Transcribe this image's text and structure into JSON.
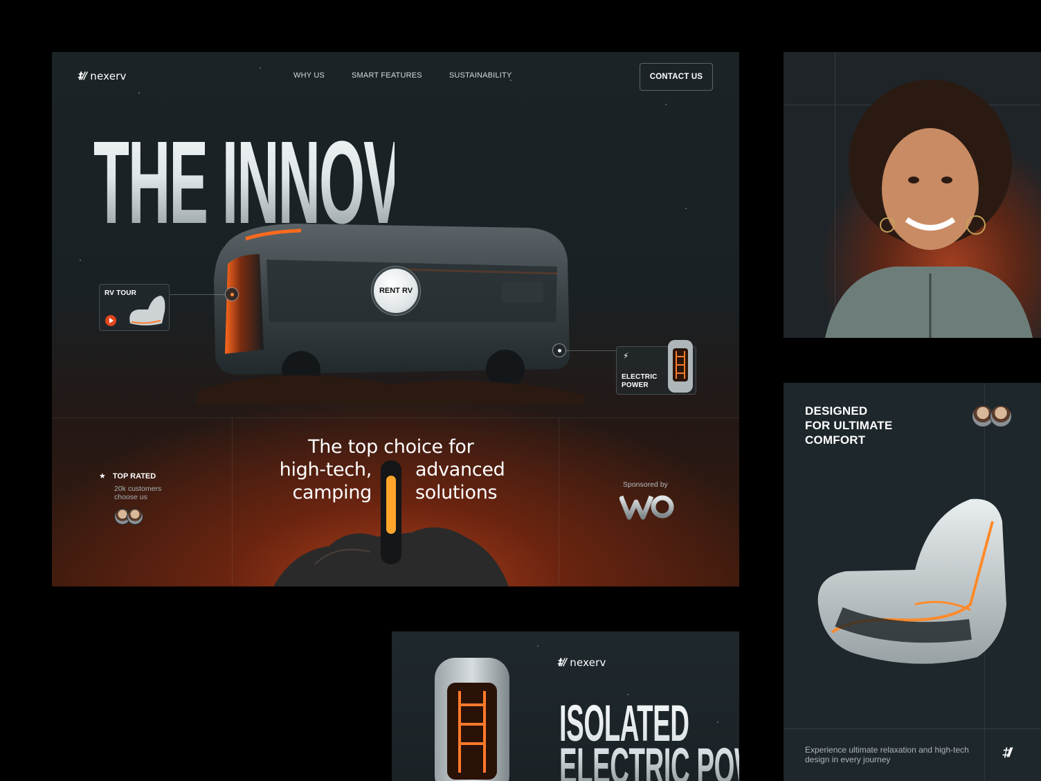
{
  "brand": {
    "name": "nexerv",
    "mark": "‡//"
  },
  "nav": {
    "items": [
      "WHY US",
      "SMART FEATURES",
      "SUSTAINABILITY"
    ],
    "contact": "CONTACT US"
  },
  "hero": {
    "headline": "THE INNOVATIVE TRAVEL",
    "rv_tour": "RV TOUR",
    "rent": "RENT RV",
    "electric_power": "ELECTRIC POWER",
    "tagline": {
      "line1": "The top choice for",
      "left2": "high-tech,",
      "left3": "camping",
      "right2": "advanced",
      "right3": "solutions"
    },
    "rated": {
      "title": "TOP RATED",
      "sub": "20k customers choose us"
    },
    "sponsor": "Sponsored by"
  },
  "comfort": {
    "title_line1": "DESIGNED",
    "title_line2": "FOR ULTIMATE",
    "title_line3": "COMFORT",
    "description": "Experience ultimate relaxation and high-tech design in every journey"
  },
  "battery": {
    "brand": "nexerv",
    "title_line1": "ISOLATED",
    "title_line2": "ELECTRIC POWER"
  },
  "colors": {
    "accent": "#ff7a2a",
    "panel": "#1e272c",
    "background": "#000000"
  },
  "icons": [
    "play-icon",
    "star-icon",
    "lightning-icon",
    "sponsor-logo",
    "brand-logo"
  ]
}
